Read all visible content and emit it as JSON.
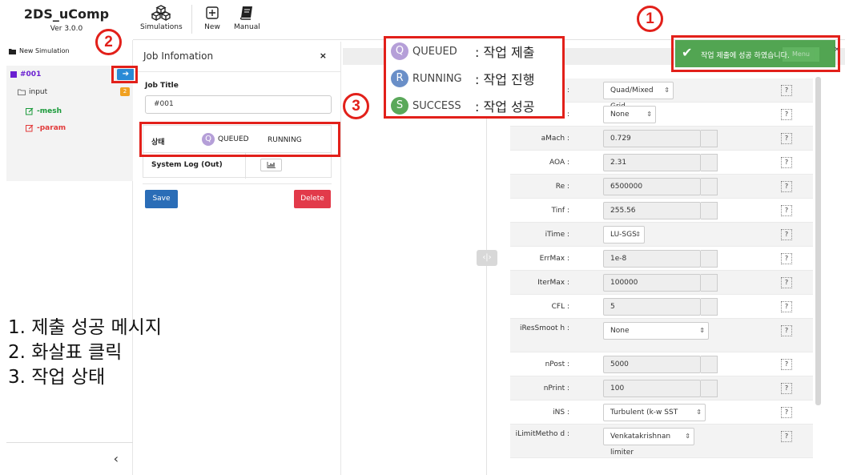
{
  "app": {
    "title": "2DS_uComp",
    "version": "Ver 3.0.0"
  },
  "toolbar": {
    "simulations": "Simulations",
    "new": "New",
    "manual": "Manual"
  },
  "sidebar": {
    "new_simulation": "New Simulation",
    "job": "#001",
    "input": "input",
    "input_count": "2",
    "mesh": "-mesh",
    "param": "-param",
    "collapse_icon": "‹"
  },
  "job_panel": {
    "title": "Job Infomation",
    "close": "×",
    "job_title_label": "Job Title",
    "job_title_value": "#001",
    "status_label": "상태",
    "status_queued": "QUEUED",
    "status_running": "RUNNING",
    "system_log_label": "System Log (Out)",
    "save": "Save",
    "delete": "Delete"
  },
  "toast": {
    "message": "작업 제출에 성공 하였습니다.",
    "menu": "Menu",
    "close": "×",
    "color": "#52a552"
  },
  "legend": [
    {
      "letter": "Q",
      "name": "QUEUED",
      "desc": ": 작업 제출",
      "color": "#b59fd8"
    },
    {
      "letter": "R",
      "name": "RUNNING",
      "desc": ": 작업 진행",
      "color": "#6a8fc8"
    },
    {
      "letter": "S",
      "name": "SUCCESS",
      "desc": ": 작업 성공",
      "color": "#5aa85a"
    }
  ],
  "params": [
    {
      "label": ":",
      "value": "Quad/Mixed Grid",
      "kind": "select"
    },
    {
      "label": ":",
      "value": "None",
      "kind": "select"
    },
    {
      "label": "aMach :",
      "value": "0.729",
      "kind": "input"
    },
    {
      "label": "AOA :",
      "value": "2.31",
      "kind": "input"
    },
    {
      "label": "Re :",
      "value": "6500000",
      "kind": "input"
    },
    {
      "label": "Tinf :",
      "value": "255.56",
      "kind": "input"
    },
    {
      "label": "iTime :",
      "value": "LU-SGS",
      "kind": "select"
    },
    {
      "label": "ErrMax :",
      "value": "1e-8",
      "kind": "input"
    },
    {
      "label": "IterMax :",
      "value": "100000",
      "kind": "input"
    },
    {
      "label": "CFL :",
      "value": "5",
      "kind": "input"
    },
    {
      "label": "iResSmoot h :",
      "value": "None",
      "kind": "select"
    },
    {
      "label": "nPost :",
      "value": "5000",
      "kind": "input"
    },
    {
      "label": "nPrint :",
      "value": "100",
      "kind": "input"
    },
    {
      "label": "iNS :",
      "value": "Turbulent (k-w SST model)",
      "kind": "select"
    },
    {
      "label": "iLimitMetho d :",
      "value": "Venkatakrishnan limiter",
      "kind": "select"
    }
  ],
  "help_glyph": "?",
  "annotations": {
    "one": "1",
    "two": "2",
    "three": "3"
  },
  "notes": [
    "1. 제출 성공 메시지",
    "2. 화살표 클릭",
    "3. 작업 상태"
  ]
}
